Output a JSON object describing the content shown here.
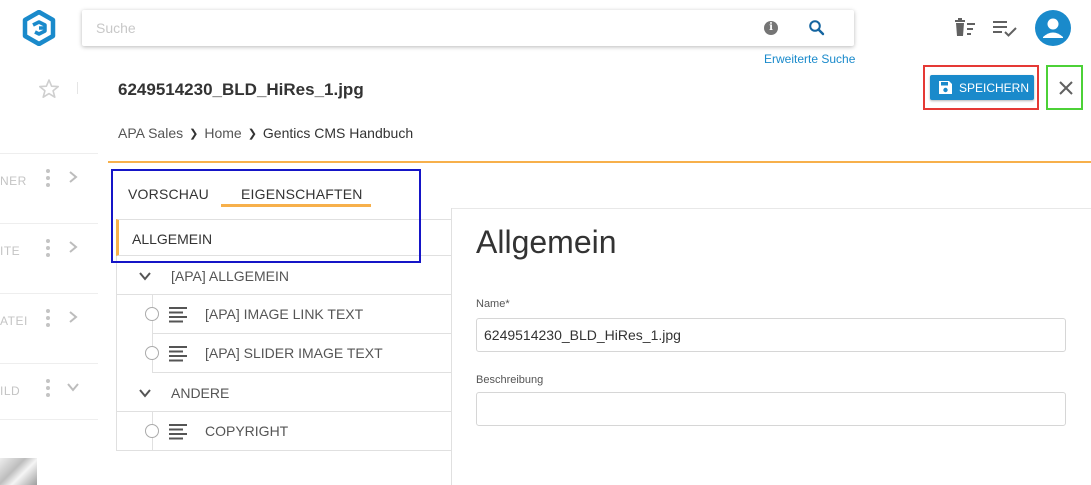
{
  "search": {
    "placeholder": "Suche",
    "advanced_link": "Erweiterte Suche"
  },
  "file": {
    "title": "6249514230_BLD_HiRes_1.jpg"
  },
  "breadcrumb": [
    "APA Sales",
    "Home",
    "Gentics CMS Handbuch"
  ],
  "toolbar": {
    "save_label": "SPEICHERN"
  },
  "left_list": [
    {
      "label": "NER",
      "chevron": "chevron-right"
    },
    {
      "label": "ITE",
      "chevron": "chevron-right"
    },
    {
      "label": "ATEI",
      "chevron": "chevron-right"
    },
    {
      "label": "ILD",
      "chevron": "chevron-down"
    }
  ],
  "tabs": [
    {
      "label": "VORSCHAU",
      "active": false
    },
    {
      "label": "EIGENSCHAFTEN",
      "active": true
    }
  ],
  "tree": {
    "selected": "ALLGEMEIN",
    "groups": [
      {
        "label": "[APA] ALLGEMEIN",
        "items": [
          "[APA] IMAGE LINK TEXT",
          "[APA] SLIDER IMAGE TEXT"
        ]
      },
      {
        "label": "ANDERE",
        "items": [
          "COPYRIGHT"
        ]
      }
    ]
  },
  "form": {
    "section_title": "Allgemein",
    "name_label": "Name*",
    "name_value": "6249514230_BLD_HiRes_1.jpg",
    "description_label": "Beschreibung",
    "description_value": ""
  },
  "colors": {
    "accent": "#1a8acb",
    "tab_indicator": "#f7b04b"
  }
}
